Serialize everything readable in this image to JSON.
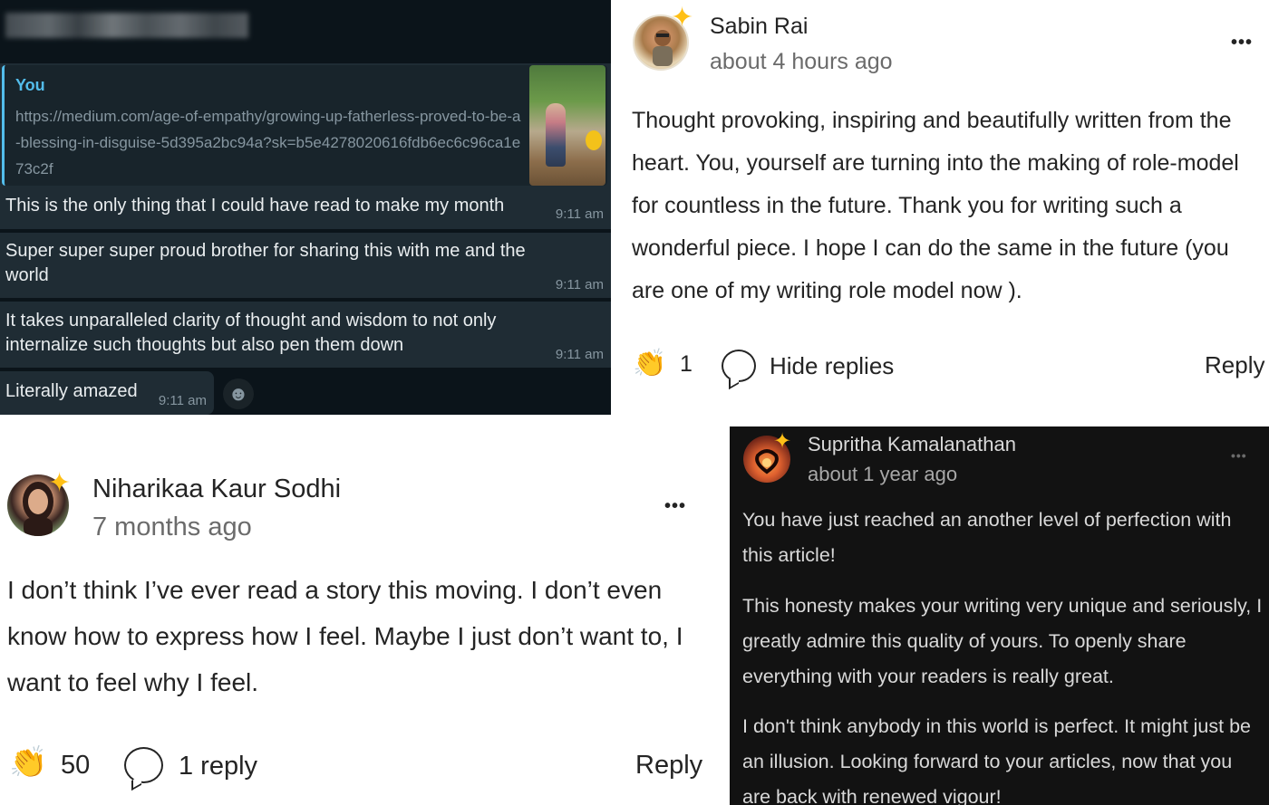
{
  "whatsapp": {
    "quoted": {
      "author": "You",
      "link": "https://medium.com/age-of-empathy/growing-up-fatherless-proved-to-be-a-blessing-in-disguise-5d395a2bc94a?sk=b5e4278020616fdb6ec6c96ca1e73c2f"
    },
    "messages": [
      {
        "text": "This is the only thing that I could have read to make my month",
        "time": "9:11 am"
      },
      {
        "text": "Super super super proud brother for sharing this with me and the world",
        "time": "9:11 am"
      },
      {
        "text": "It takes unparalleled clarity of thought and wisdom to not only internalize such thoughts but also pen them down",
        "time": "9:11 am"
      },
      {
        "text": "Literally amazed",
        "time": "9:11 am"
      }
    ],
    "emoji_button": "☻"
  },
  "sabin": {
    "name": "Sabin Rai",
    "time": "about 4 hours ago",
    "body": "Thought provoking, inspiring and beautifully written from the heart. You, yourself are turning into the making of role-model for countless in the future. Thank you for writing such a wonderful piece. I hope I can do the same in the future (you are one of my writing role model now   ).",
    "claps": "1",
    "replies_label": "Hide replies",
    "reply_label": "Reply"
  },
  "niharikaa": {
    "name": "Niharikaa Kaur Sodhi",
    "time": "7 months ago",
    "body": "I don’t think I’ve ever read a story this moving. I don’t even know how to express how I feel. Maybe I just don’t want to, I want to feel why I feel.",
    "claps": "50",
    "replies_label": "1 reply",
    "reply_label": "Reply"
  },
  "supritha": {
    "name": "Supritha Kamalanathan",
    "time": "about 1 year ago",
    "paragraphs": [
      "You have just reached an another level of perfection with this article!",
      "This honesty makes your writing very unique and seriously, I greatly admire this quality of yours. To openly share everything with your readers is really great.",
      "I don't think anybody in this world is perfect. It might just be an illusion. Looking forward to your articles, now that you are back with renewed vigour!"
    ]
  },
  "icons": {
    "more": "•••",
    "star": "✦",
    "clap": "👏"
  }
}
